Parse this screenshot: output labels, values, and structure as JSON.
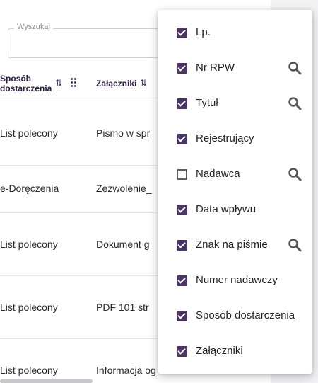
{
  "search": {
    "legend": "Wyszukaj"
  },
  "table": {
    "headers": {
      "delivery_line1": "Sposób",
      "delivery_line2": "dostarczenia",
      "attachments": "Załączniki"
    },
    "rows": [
      {
        "delivery": "List polecony",
        "attachment": "Pismo w spr"
      },
      {
        "delivery": "e-Doręczenia",
        "attachment": "Zezwolenie_"
      },
      {
        "delivery": "List polecony",
        "attachment": "Dokument g"
      },
      {
        "delivery": "List polecony",
        "attachment": "PDF 101 str"
      },
      {
        "delivery": "List polecony",
        "attachment": "Informacja og"
      }
    ]
  },
  "column_chooser": {
    "options": [
      {
        "label": "Lp.",
        "checked": true,
        "searchable": false
      },
      {
        "label": "Nr RPW",
        "checked": true,
        "searchable": true
      },
      {
        "label": "Tytuł",
        "checked": true,
        "searchable": true
      },
      {
        "label": "Rejestrujący",
        "checked": true,
        "searchable": false
      },
      {
        "label": "Nadawca",
        "checked": false,
        "searchable": true
      },
      {
        "label": "Data wpływu",
        "checked": true,
        "searchable": false
      },
      {
        "label": "Znak na piśmie",
        "checked": true,
        "searchable": true
      },
      {
        "label": "Numer nadawczy",
        "checked": true,
        "searchable": false
      },
      {
        "label": "Sposób dostarczenia",
        "checked": true,
        "searchable": false
      },
      {
        "label": "Załączniki",
        "checked": true,
        "searchable": false
      }
    ]
  },
  "icons": {
    "search": "search-icon",
    "sort": "sort-arrows-icon",
    "drag": "drag-handle-icon"
  },
  "colors": {
    "checkbox_checked": "#4a3565",
    "header_text": "#2d1e45",
    "icon": "#555555"
  }
}
